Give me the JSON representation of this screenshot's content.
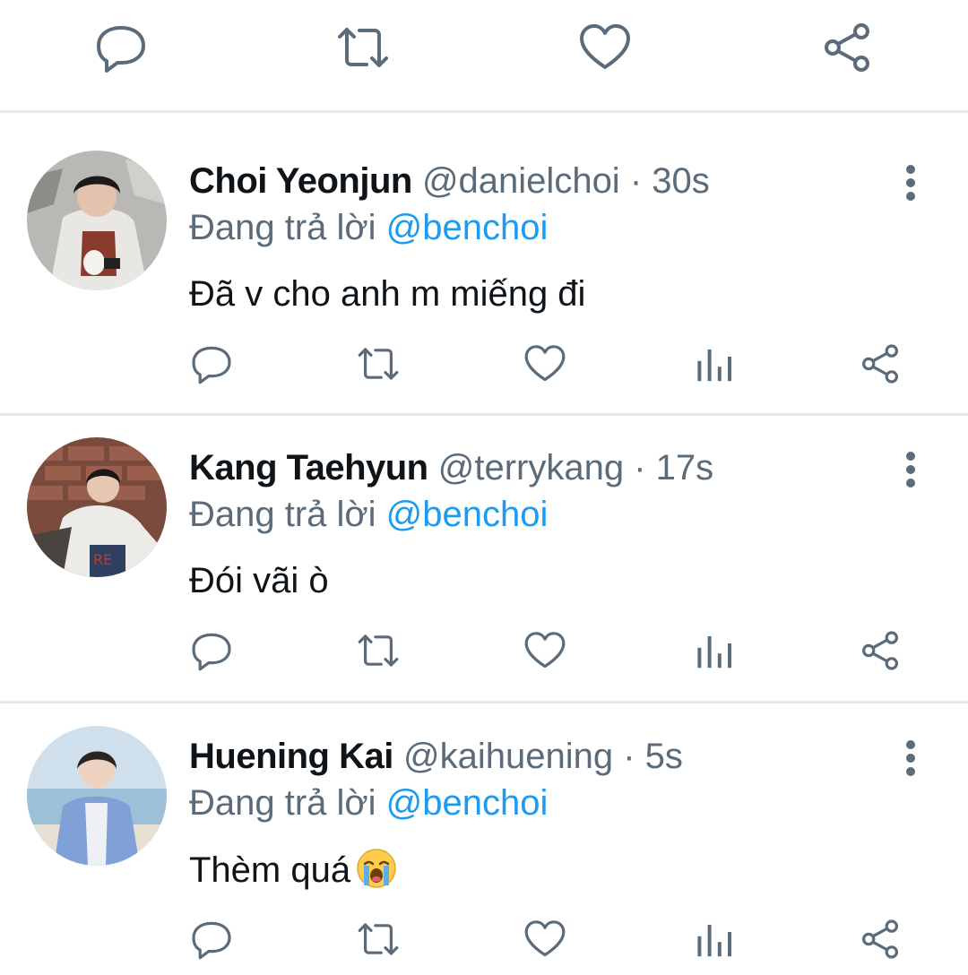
{
  "top_actions": [
    {
      "icon": "reply-icon"
    },
    {
      "icon": "retweet-icon"
    },
    {
      "icon": "like-icon"
    },
    {
      "icon": "share-icon"
    }
  ],
  "colors": {
    "icon_gray": "#5b6b79",
    "mention_blue": "#1d9bf0",
    "divider": "#e6e8ea",
    "text": "#0f1419"
  },
  "replies": [
    {
      "name": "Choi Yeonjun",
      "handle": "@danielchoi",
      "separator": "·",
      "time": "30s",
      "reply_prefix": "Đang trả lời",
      "reply_to": "@benchoi",
      "text": "Đã v cho anh m miếng đi",
      "emoji": ""
    },
    {
      "name": "Kang Taehyun",
      "handle": "@terrykang",
      "separator": "·",
      "time": "17s",
      "reply_prefix": "Đang trả lời",
      "reply_to": "@benchoi",
      "text": "Đói vãi ò",
      "emoji": ""
    },
    {
      "name": "Huening Kai",
      "handle": "@kaihuening",
      "separator": "·",
      "time": "5s",
      "reply_prefix": "Đang trả lời",
      "reply_to": "@benchoi",
      "text": "Thèm quá",
      "emoji": "loudly-crying-face"
    }
  ]
}
